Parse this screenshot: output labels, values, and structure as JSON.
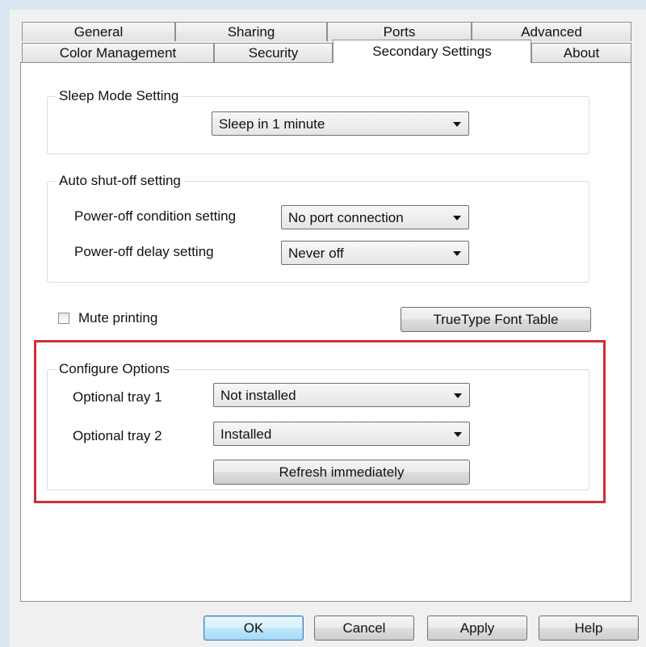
{
  "tabs_row1": [
    "General",
    "Sharing",
    "Ports",
    "Advanced"
  ],
  "tabs_row2": [
    "Color Management",
    "Security",
    "Secondary Settings",
    "About"
  ],
  "sleep_group": {
    "legend": "Sleep Mode Setting",
    "selected": "Sleep in 1 minute"
  },
  "auto_shutoff": {
    "legend": "Auto shut-off setting",
    "condition_label": "Power-off condition setting",
    "condition_value": "No port connection",
    "delay_label": "Power-off delay setting",
    "delay_value": "Never off"
  },
  "mute": {
    "label": "Mute printing",
    "checked": false
  },
  "truetype_button": "TrueType Font Table",
  "configure": {
    "legend": "Configure Options",
    "tray1_label": "Optional tray 1",
    "tray1_value": "Not installed",
    "tray2_label": "Optional tray 2",
    "tray2_value": "Installed",
    "refresh_button": "Refresh immediately",
    "highlight_color": "#d02e3a"
  },
  "dialog_buttons": {
    "ok": "OK",
    "cancel": "Cancel",
    "apply": "Apply",
    "help": "Help"
  }
}
